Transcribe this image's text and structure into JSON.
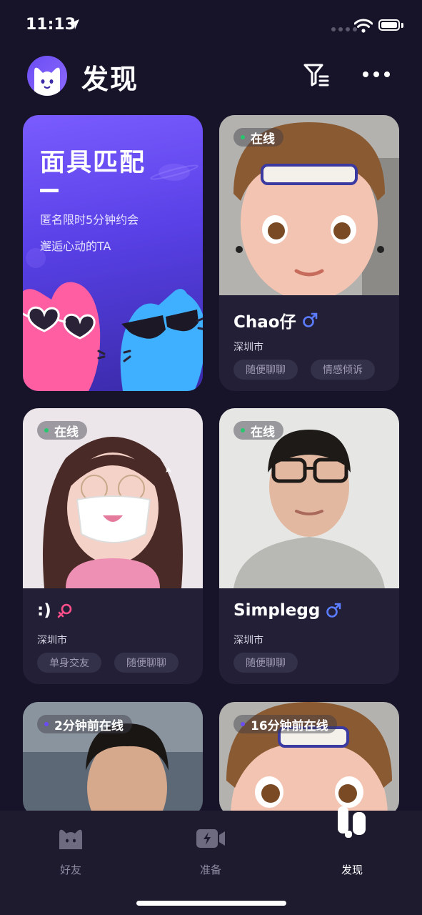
{
  "status_bar": {
    "time": "11:13"
  },
  "header": {
    "title": "发现"
  },
  "promo": {
    "title": "面具匹配",
    "line1": "匿名限时5分钟约会",
    "line2": "邂逅心动的TA"
  },
  "cards": [
    {
      "status": "在线",
      "name": "Chao仔",
      "gender": "male",
      "city": "深圳市",
      "tags": [
        "随便聊聊",
        "情感倾诉"
      ]
    },
    {
      "status": "在线",
      "name": ":)",
      "gender": "female",
      "city": "深圳市",
      "tags": [
        "单身交友",
        "随便聊聊"
      ]
    },
    {
      "status": "在线",
      "name": "Simplegg",
      "gender": "male",
      "city": "深圳市",
      "tags": [
        "随便聊聊"
      ]
    },
    {
      "status": "2分钟前在线"
    },
    {
      "status": "16分钟前在线"
    }
  ],
  "tabbar": {
    "items": [
      {
        "label": "好友",
        "active": false
      },
      {
        "label": "准备",
        "active": false
      },
      {
        "label": "发现",
        "active": true
      }
    ]
  },
  "colors": {
    "accent": "#6a4cf2",
    "male": "#5b7cff",
    "female": "#ff4f8a",
    "online": "#28c76f"
  }
}
